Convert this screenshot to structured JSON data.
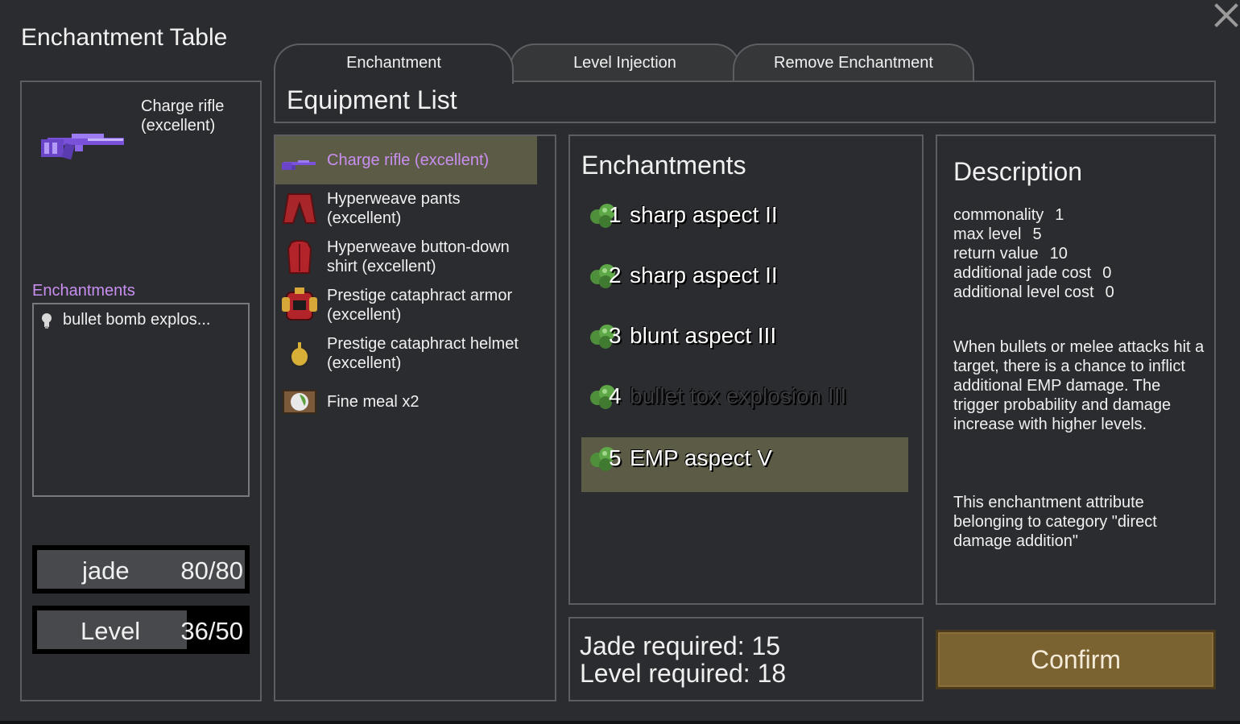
{
  "window": {
    "title": "Enchantment Table"
  },
  "selected_item": {
    "name": "Charge rifle (excellent)",
    "enchantments_label": "Enchantments",
    "enchantments": [
      "bullet bomb explos..."
    ]
  },
  "resources": {
    "jade": {
      "label": "jade",
      "value": "80/80",
      "fill": 1.0
    },
    "level": {
      "label": "Level",
      "value": "36/50",
      "fill": 0.72
    }
  },
  "tabs": [
    {
      "label": "Enchantment",
      "active": true
    },
    {
      "label": "Level Injection",
      "active": false
    },
    {
      "label": "Remove Enchantment",
      "active": false
    }
  ],
  "equipment_list": {
    "title": "Equipment List",
    "items": [
      {
        "name": "Charge rifle (excellent)",
        "icon": "charge-rifle-icon",
        "selected": true
      },
      {
        "name": "Hyperweave pants (excellent)",
        "icon": "pants-icon",
        "selected": false
      },
      {
        "name": "Hyperweave button-down shirt (excellent)",
        "icon": "shirt-icon",
        "selected": false
      },
      {
        "name": "Prestige cataphract armor (excellent)",
        "icon": "armor-icon",
        "selected": false
      },
      {
        "name": "Prestige cataphract helmet (excellent)",
        "icon": "helmet-icon",
        "selected": false
      },
      {
        "name": "Fine meal x2",
        "icon": "meal-icon",
        "selected": false
      }
    ]
  },
  "enchantments_panel": {
    "title": "Enchantments",
    "options": [
      {
        "num": "1",
        "name": "sharp aspect II",
        "enabled": true,
        "selected": false
      },
      {
        "num": "2",
        "name": "sharp aspect II",
        "enabled": true,
        "selected": false
      },
      {
        "num": "3",
        "name": "blunt aspect III",
        "enabled": true,
        "selected": false
      },
      {
        "num": "4",
        "name": "bullet tox explosion III",
        "enabled": false,
        "selected": false
      },
      {
        "num": "5",
        "name": "EMP aspect V",
        "enabled": true,
        "selected": true
      }
    ]
  },
  "description": {
    "title": "Description",
    "stats": [
      {
        "label": "commonality",
        "value": "1"
      },
      {
        "label": "max level",
        "value": "5"
      },
      {
        "label": "return value",
        "value": "10"
      },
      {
        "label": "additional jade cost",
        "value": "0"
      },
      {
        "label": "additional level cost",
        "value": "0"
      }
    ],
    "text1": "When bullets or melee attacks hit a target, there is a chance to inflict additional EMP damage. The trigger probability and damage increase with higher levels.",
    "text2": "This enchantment attribute belonging to category \"direct damage addition\""
  },
  "requirements": {
    "jade": "Jade required: 15",
    "level": "Level required: 18"
  },
  "confirm_label": "Confirm",
  "colors": {
    "accent_purple": "#c88ff0",
    "selected_row": "#5c5b46",
    "confirm": "#7b6231"
  }
}
